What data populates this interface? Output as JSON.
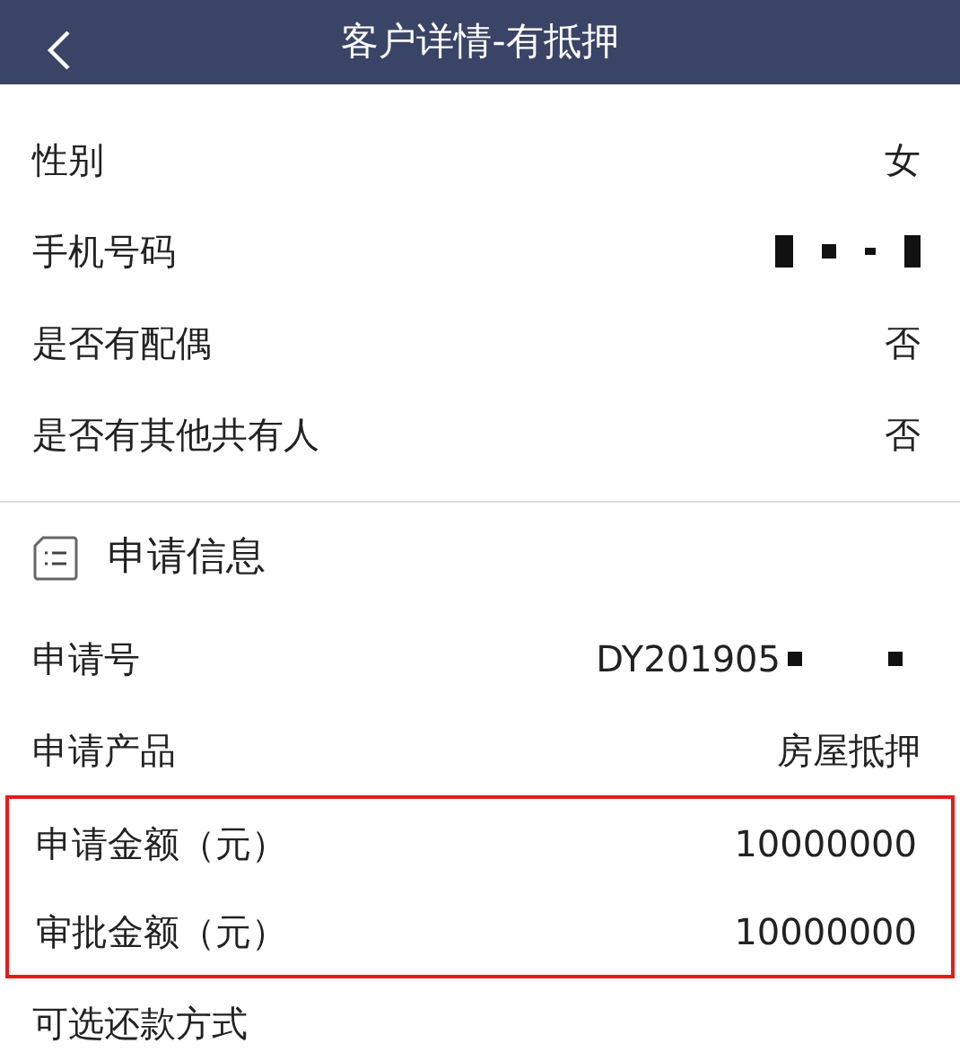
{
  "header": {
    "title": "客户详情-有抵押"
  },
  "customer_rows": [
    {
      "label": "性别",
      "kind": "text",
      "value": "女"
    },
    {
      "label": "手机号码",
      "kind": "redacted"
    },
    {
      "label": "是否有配偶",
      "kind": "text",
      "value": "否"
    },
    {
      "label": "是否有其他共有人",
      "kind": "text",
      "value": "否"
    }
  ],
  "application": {
    "title": "申请信息",
    "rows": [
      {
        "label": "申请号",
        "value": "DY201905",
        "redacted": true,
        "highlighted": false
      },
      {
        "label": "申请产品",
        "value": "房屋抵押",
        "redacted": false,
        "highlighted": false
      },
      {
        "label": "申请金额（元）",
        "value": "10000000",
        "redacted": false,
        "highlighted": true
      },
      {
        "label": "审批金额（元）",
        "value": "10000000",
        "redacted": false,
        "highlighted": true
      },
      {
        "label": "可选还款方式",
        "highlighted": false
      }
    ]
  }
}
